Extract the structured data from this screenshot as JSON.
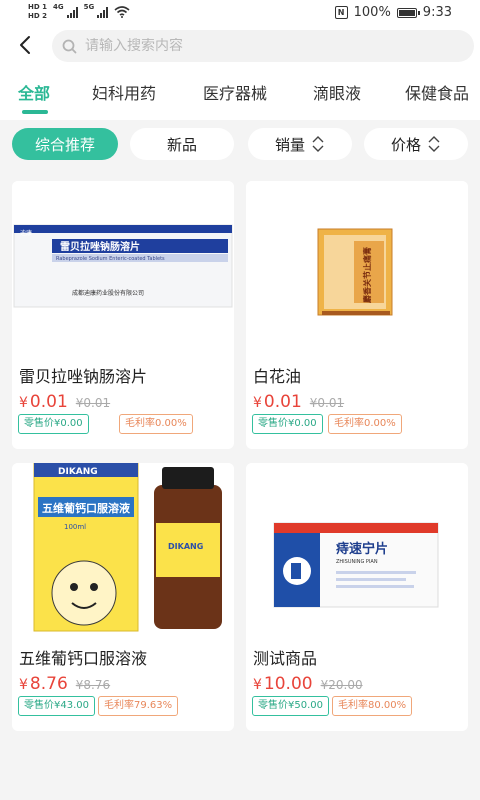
{
  "status_bar": {
    "hd1": "HD 1",
    "hd2": "HD 2",
    "net1": "4G",
    "net2": "5G",
    "battery": "100%",
    "time": "9:33"
  },
  "header": {
    "search_placeholder": "请输入搜索内容"
  },
  "tabs": [
    "全部",
    "妇科用药",
    "医疗器械",
    "滴眼液",
    "保健食品"
  ],
  "filters": {
    "recommended": "综合推荐",
    "new": "新品",
    "sales": "销量",
    "price": "价格"
  },
  "products": [
    {
      "name": "雷贝拉唑钠肠溶片",
      "price": "0.01",
      "original_price": "¥0.01",
      "retail_label": "零售价¥0.00",
      "margin_label": "毛利率0.00%",
      "box_brand": "迪康",
      "box_title": "雷贝拉唑钠肠溶片",
      "box_subtitle": "Rabeprazole Sodium Enteric-coated Tablets",
      "box_maker": "成都迪康药业股份有限公司"
    },
    {
      "name": "白花油",
      "price": "0.01",
      "original_price": "¥0.01",
      "retail_label": "零售价¥0.00",
      "margin_label": "毛利率0.00%",
      "box_title": "麝香关节止痛膏"
    },
    {
      "name": "五维葡钙口服溶液",
      "price": "8.76",
      "original_price": "¥8.76",
      "retail_label": "零售价¥43.00",
      "margin_label": "毛利率79.63%",
      "box_brand": "DIKANG",
      "box_title": "五维葡钙口服溶液",
      "box_volume": "100ml"
    },
    {
      "name": "测试商品",
      "price": "10.00",
      "original_price": "¥20.00",
      "retail_label": "零售价¥50.00",
      "margin_label": "毛利率80.00%",
      "box_title": "痔速宁片",
      "box_subtitle": "ZHISUNING PIAN"
    }
  ],
  "colors": {
    "accent": "#34c09e",
    "price": "#e8443a",
    "margin_tag": "#f0a77a"
  }
}
